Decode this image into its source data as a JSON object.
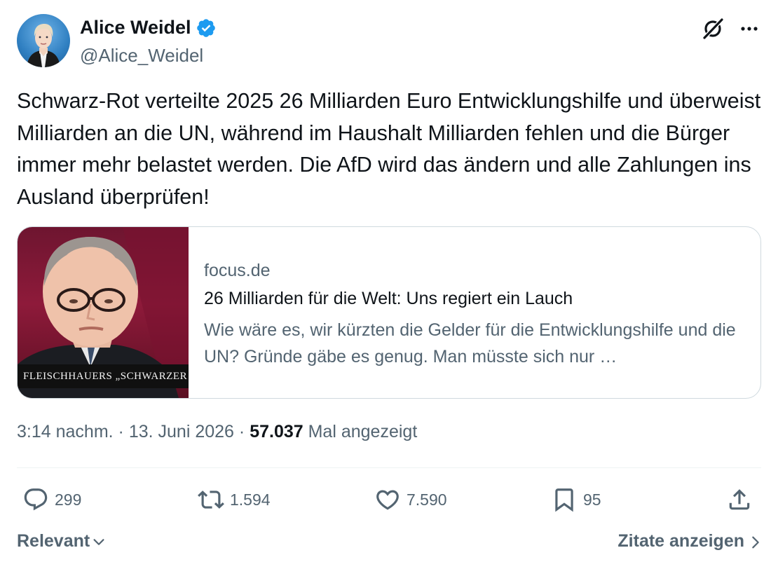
{
  "author": {
    "display_name": "Alice Weidel",
    "handle": "@Alice_Weidel",
    "verified_icon": "verified-badge-icon",
    "verified_color": "#1d9bf0"
  },
  "header_icons": {
    "grok": "grok-icon",
    "more": "more-icon"
  },
  "tweet": {
    "text": "Schwarz-Rot verteilte 2025 26 Milliarden Euro Entwicklungshilfe und überweist Milliarden an die UN, während im Haushalt Milliarden fehlen und die Bürger immer mehr belastet werden. Die AfD wird das ändern und alle Zahlungen ins Ausland überprüfen!"
  },
  "link_card": {
    "thumbnail_caption": "FLEISCHHAUERS „SCHWARZER KANAL",
    "domain": "focus.de",
    "title": "26 Milliarden für die Welt: Uns regiert ein Lauch",
    "description": "Wie wäre es, wir kürzten die Gelder für die Entwicklungshilfe und die UN? Gründe gäbe es genug. Man müsste sich nur …"
  },
  "meta": {
    "time": "3:14 nachm.",
    "separator": "·",
    "date": "13. Juni 2026",
    "views_count": "57.037",
    "views_label": "Mal angezeigt"
  },
  "actions": {
    "replies": "299",
    "reposts": "1.594",
    "likes": "7.590",
    "bookmarks": "95"
  },
  "footer": {
    "sort_label": "Relevant",
    "quotes_label": "Zitate anzeigen"
  },
  "colors": {
    "text_primary": "#0f1419",
    "text_secondary": "#536471",
    "border": "#cfd9de",
    "accent": "#1d9bf0"
  }
}
